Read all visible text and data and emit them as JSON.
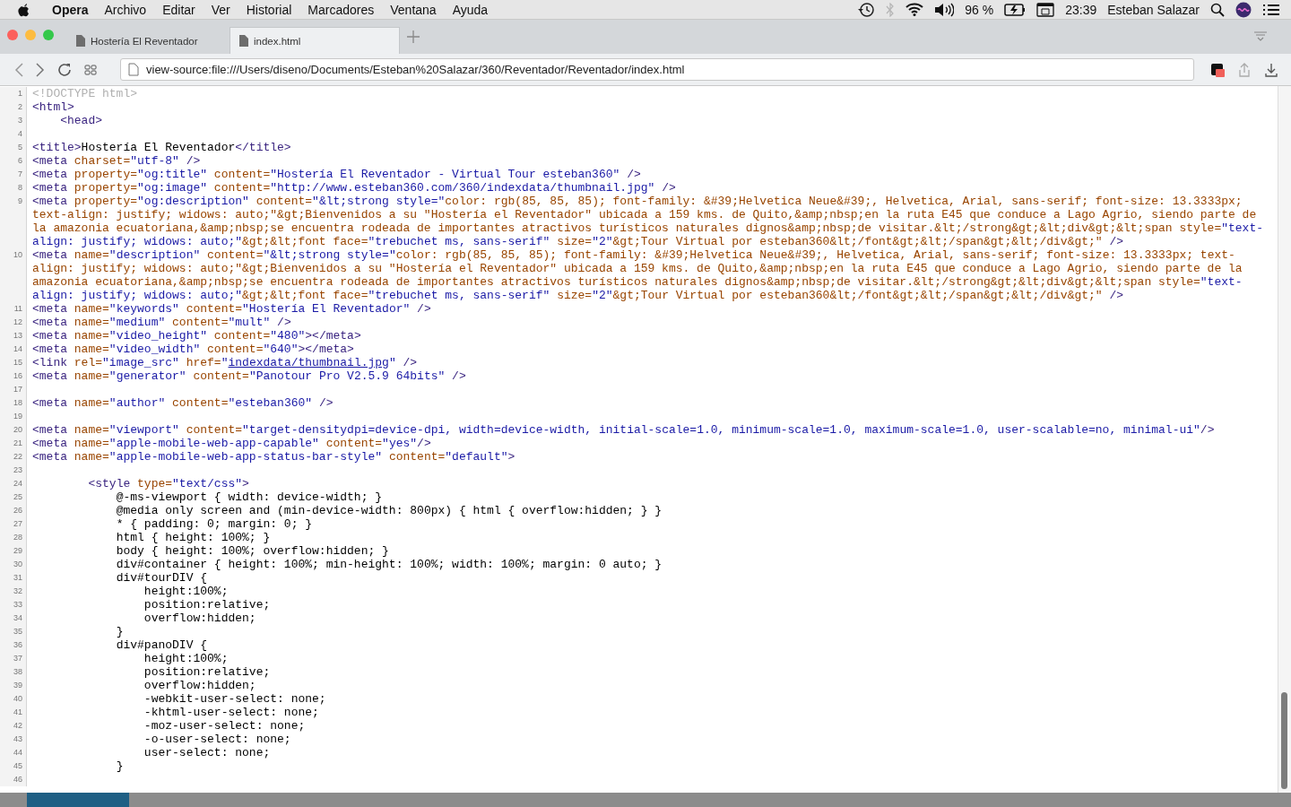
{
  "menubar": {
    "app": "Opera",
    "menus": [
      "Archivo",
      "Editar",
      "Ver",
      "Historial",
      "Marcadores",
      "Ventana",
      "Ayuda"
    ],
    "battery": "96 %",
    "clock": "23:39",
    "user": "Esteban Salazar"
  },
  "tabs": [
    {
      "title": "Hostería El Reventador",
      "selected": false
    },
    {
      "title": "index.html",
      "selected": true
    }
  ],
  "address_bar": {
    "value": "view-source:file:///Users/diseno/Documents/Esteban%20Salazar/360/Reventador/Reventador/index.html"
  },
  "source_lines": [
    {
      "number": "1",
      "segments": [
        {
          "kind": "doctype",
          "text": "<!DOCTYPE html>"
        }
      ]
    },
    {
      "number": "2",
      "segments": [
        {
          "kind": "tag",
          "text": "<html>"
        }
      ]
    },
    {
      "number": "3",
      "segments": [
        {
          "kind": "tag",
          "text": "    <head>"
        }
      ]
    },
    {
      "number": "4"
    },
    {
      "number": "5",
      "segments": [
        {
          "kind": "tag",
          "text": "<title>"
        },
        {
          "kind": "text",
          "text": "Hostería El Reventador"
        },
        {
          "kind": "tag",
          "text": "</title>"
        }
      ]
    },
    {
      "number": "6",
      "segments": [
        {
          "kind": "tag",
          "text": "<meta"
        },
        {
          "kind": "attr",
          "text": " charset="
        },
        {
          "kind": "value",
          "text": "\"utf-8\""
        },
        {
          "kind": "tag",
          "text": " />"
        }
      ]
    },
    {
      "number": "7",
      "segments": [
        {
          "kind": "tag",
          "text": "<meta"
        },
        {
          "kind": "attr",
          "text": " property="
        },
        {
          "kind": "value",
          "text": "\"og:title\""
        },
        {
          "kind": "attr",
          "text": " content="
        },
        {
          "kind": "value",
          "text": "\"Hostería El Reventador - Virtual Tour esteban360\""
        },
        {
          "kind": "tag",
          "text": " />"
        }
      ]
    },
    {
      "number": "8",
      "segments": [
        {
          "kind": "tag",
          "text": "<meta"
        },
        {
          "kind": "attr",
          "text": " property="
        },
        {
          "kind": "value",
          "text": "\"og:image\""
        },
        {
          "kind": "attr",
          "text": " content="
        },
        {
          "kind": "value",
          "text": "\"http://www.esteban360.com/360/indexdata/thumbnail.jpg\""
        },
        {
          "kind": "tag",
          "text": " />"
        }
      ]
    },
    {
      "number": "9",
      "segments": [
        {
          "kind": "tag",
          "text": "<meta"
        },
        {
          "kind": "attr",
          "text": " property="
        },
        {
          "kind": "value",
          "text": "\"og:description\""
        },
        {
          "kind": "attr",
          "text": " content="
        },
        {
          "kind": "value",
          "text": "\"&lt;strong style=\""
        },
        {
          "kind": "attr",
          "text": "color: rgb(85, 85, 85); font-family: &#39;Helvetica Neue&#39;, Helvetica, Arial, sans-serif; font-size: 13.3333px; text-align: justify; widows: auto;\"&gt;Bienvenidos a su \"Hostería el Reventador\" ubicada a 159 kms. de Quito,&amp;nbsp;en la ruta E45 que conduce a Lago Agrio, siendo parte de la amazonia ecuatoriana,&amp;nbsp;se encuentra rodeada de importantes atractivos turísticos naturales dignos&amp;nbsp;de visitar.&lt;/strong&gt;&lt;div&gt;&lt;span style="
        },
        {
          "kind": "value",
          "text": "\"text-align: justify; widows: auto;\""
        },
        {
          "kind": "attr",
          "text": "&gt;&lt;font face="
        },
        {
          "kind": "value",
          "text": "\"trebuchet ms, sans-serif\""
        },
        {
          "kind": "attr",
          "text": " size="
        },
        {
          "kind": "value",
          "text": "\"2\""
        },
        {
          "kind": "attr",
          "text": "&gt;Tour Virtual por esteban360&lt;/font&gt;&lt;/span&gt;&lt;/div&gt;\""
        },
        {
          "kind": "tag",
          "text": " />"
        }
      ]
    },
    {
      "number": "10",
      "segments": [
        {
          "kind": "tag",
          "text": "<meta"
        },
        {
          "kind": "attr",
          "text": " name="
        },
        {
          "kind": "value",
          "text": "\"description\""
        },
        {
          "kind": "attr",
          "text": " content="
        },
        {
          "kind": "value",
          "text": "\"&lt;strong style=\""
        },
        {
          "kind": "attr",
          "text": "color: rgb(85, 85, 85); font-family: &#39;Helvetica Neue&#39;, Helvetica, Arial, sans-serif; font-size: 13.3333px; text-align: justify; widows: auto;\"&gt;Bienvenidos a su \"Hostería el Reventador\" ubicada a 159 kms. de Quito,&amp;nbsp;en la ruta E45 que conduce a Lago Agrio, siendo parte de la amazonia ecuatoriana,&amp;nbsp;se encuentra rodeada de importantes atractivos turísticos naturales dignos&amp;nbsp;de visitar.&lt;/strong&gt;&lt;div&gt;&lt;span style="
        },
        {
          "kind": "value",
          "text": "\"text-align: justify; widows: auto;\""
        },
        {
          "kind": "attr",
          "text": "&gt;&lt;font face="
        },
        {
          "kind": "value",
          "text": "\"trebuchet ms, sans-serif\""
        },
        {
          "kind": "attr",
          "text": " size="
        },
        {
          "kind": "value",
          "text": "\"2\""
        },
        {
          "kind": "attr",
          "text": "&gt;Tour Virtual por esteban360&lt;/font&gt;&lt;/span&gt;&lt;/div&gt;\""
        },
        {
          "kind": "tag",
          "text": " />"
        }
      ]
    },
    {
      "number": "11",
      "segments": [
        {
          "kind": "tag",
          "text": "<meta"
        },
        {
          "kind": "attr",
          "text": " name="
        },
        {
          "kind": "value",
          "text": "\"keywords\""
        },
        {
          "kind": "attr",
          "text": " content="
        },
        {
          "kind": "value",
          "text": "\"Hostería El Reventador\""
        },
        {
          "kind": "tag",
          "text": " />"
        }
      ]
    },
    {
      "number": "12",
      "segments": [
        {
          "kind": "tag",
          "text": "<meta"
        },
        {
          "kind": "attr",
          "text": " name="
        },
        {
          "kind": "value",
          "text": "\"medium\""
        },
        {
          "kind": "attr",
          "text": " content="
        },
        {
          "kind": "value",
          "text": "\"mult\""
        },
        {
          "kind": "tag",
          "text": " />"
        }
      ]
    },
    {
      "number": "13",
      "segments": [
        {
          "kind": "tag",
          "text": "<meta"
        },
        {
          "kind": "attr",
          "text": " name="
        },
        {
          "kind": "value",
          "text": "\"video_height\""
        },
        {
          "kind": "attr",
          "text": " content="
        },
        {
          "kind": "value",
          "text": "\"480\""
        },
        {
          "kind": "tag",
          "text": "></meta>"
        }
      ]
    },
    {
      "number": "14",
      "segments": [
        {
          "kind": "tag",
          "text": "<meta"
        },
        {
          "kind": "attr",
          "text": " name="
        },
        {
          "kind": "value",
          "text": "\"video_width\""
        },
        {
          "kind": "attr",
          "text": " content="
        },
        {
          "kind": "value",
          "text": "\"640\""
        },
        {
          "kind": "tag",
          "text": "></meta>"
        }
      ]
    },
    {
      "number": "15",
      "segments": [
        {
          "kind": "tag",
          "text": "<link"
        },
        {
          "kind": "attr",
          "text": " rel="
        },
        {
          "kind": "value",
          "text": "\"image_src\""
        },
        {
          "kind": "attr",
          "text": " href="
        },
        {
          "kind": "value",
          "text": "\""
        },
        {
          "kind": "link",
          "text": "indexdata/thumbnail.jpg"
        },
        {
          "kind": "value",
          "text": "\""
        },
        {
          "kind": "tag",
          "text": " />"
        }
      ]
    },
    {
      "number": "16",
      "segments": [
        {
          "kind": "tag",
          "text": "<meta"
        },
        {
          "kind": "attr",
          "text": " name="
        },
        {
          "kind": "value",
          "text": "\"generator\""
        },
        {
          "kind": "attr",
          "text": " content="
        },
        {
          "kind": "value",
          "text": "\"Panotour Pro V2.5.9 64bits\""
        },
        {
          "kind": "tag",
          "text": " />"
        }
      ]
    },
    {
      "number": "17"
    },
    {
      "number": "18",
      "segments": [
        {
          "kind": "tag",
          "text": "<meta"
        },
        {
          "kind": "attr",
          "text": " name="
        },
        {
          "kind": "value",
          "text": "\"author\""
        },
        {
          "kind": "attr",
          "text": " content="
        },
        {
          "kind": "value",
          "text": "\"esteban360\""
        },
        {
          "kind": "tag",
          "text": " />"
        }
      ]
    },
    {
      "number": "19"
    },
    {
      "number": "20",
      "segments": [
        {
          "kind": "tag",
          "text": "<meta"
        },
        {
          "kind": "attr",
          "text": " name="
        },
        {
          "kind": "value",
          "text": "\"viewport\""
        },
        {
          "kind": "attr",
          "text": " content="
        },
        {
          "kind": "value",
          "text": "\"target-densitydpi=device-dpi, width=device-width, initial-scale=1.0, minimum-scale=1.0, maximum-scale=1.0, user-scalable=no, minimal-ui\""
        },
        {
          "kind": "tag",
          "text": "/>"
        }
      ]
    },
    {
      "number": "21",
      "segments": [
        {
          "kind": "tag",
          "text": "<meta"
        },
        {
          "kind": "attr",
          "text": " name="
        },
        {
          "kind": "value",
          "text": "\"apple-mobile-web-app-capable\""
        },
        {
          "kind": "attr",
          "text": " content="
        },
        {
          "kind": "value",
          "text": "\"yes\""
        },
        {
          "kind": "tag",
          "text": "/>"
        }
      ]
    },
    {
      "number": "22",
      "segments": [
        {
          "kind": "tag",
          "text": "<meta"
        },
        {
          "kind": "attr",
          "text": " name="
        },
        {
          "kind": "value",
          "text": "\"apple-mobile-web-app-status-bar-style\""
        },
        {
          "kind": "attr",
          "text": " content="
        },
        {
          "kind": "value",
          "text": "\"default\""
        },
        {
          "kind": "tag",
          "text": ">"
        }
      ]
    },
    {
      "number": "23"
    },
    {
      "number": "24",
      "segments": [
        {
          "kind": "tag",
          "text": "        <style"
        },
        {
          "kind": "attr",
          "text": " type="
        },
        {
          "kind": "value",
          "text": "\"text/css\""
        },
        {
          "kind": "tag",
          "text": ">"
        }
      ]
    },
    {
      "number": "25",
      "segments": [
        {
          "kind": "text",
          "text": "            @-ms-viewport { width: device-width; }"
        }
      ]
    },
    {
      "number": "26",
      "segments": [
        {
          "kind": "text",
          "text": "            @media only screen and (min-device-width: 800px) { html { overflow:hidden; } }"
        }
      ]
    },
    {
      "number": "27",
      "segments": [
        {
          "kind": "text",
          "text": "            * { padding: 0; margin: 0; }"
        }
      ]
    },
    {
      "number": "28",
      "segments": [
        {
          "kind": "text",
          "text": "            html { height: 100%; }"
        }
      ]
    },
    {
      "number": "29",
      "segments": [
        {
          "kind": "text",
          "text": "            body { height: 100%; overflow:hidden; }"
        }
      ]
    },
    {
      "number": "30",
      "segments": [
        {
          "kind": "text",
          "text": "            div#container { height: 100%; min-height: 100%; width: 100%; margin: 0 auto; }"
        }
      ]
    },
    {
      "number": "31",
      "segments": [
        {
          "kind": "text",
          "text": "            div#tourDIV {"
        }
      ]
    },
    {
      "number": "32",
      "segments": [
        {
          "kind": "text",
          "text": "                height:100%;"
        }
      ]
    },
    {
      "number": "33",
      "segments": [
        {
          "kind": "text",
          "text": "                position:relative;"
        }
      ]
    },
    {
      "number": "34",
      "segments": [
        {
          "kind": "text",
          "text": "                overflow:hidden;"
        }
      ]
    },
    {
      "number": "35",
      "segments": [
        {
          "kind": "text",
          "text": "            }"
        }
      ]
    },
    {
      "number": "36",
      "segments": [
        {
          "kind": "text",
          "text": "            div#panoDIV {"
        }
      ]
    },
    {
      "number": "37",
      "segments": [
        {
          "kind": "text",
          "text": "                height:100%;"
        }
      ]
    },
    {
      "number": "38",
      "segments": [
        {
          "kind": "text",
          "text": "                position:relative;"
        }
      ]
    },
    {
      "number": "39",
      "segments": [
        {
          "kind": "text",
          "text": "                overflow:hidden;"
        }
      ]
    },
    {
      "number": "40",
      "segments": [
        {
          "kind": "text",
          "text": "                -webkit-user-select: none;"
        }
      ]
    },
    {
      "number": "41",
      "segments": [
        {
          "kind": "text",
          "text": "                -khtml-user-select: none;"
        }
      ]
    },
    {
      "number": "42",
      "segments": [
        {
          "kind": "text",
          "text": "                -moz-user-select: none;"
        }
      ]
    },
    {
      "number": "43",
      "segments": [
        {
          "kind": "text",
          "text": "                -o-user-select: none;"
        }
      ]
    },
    {
      "number": "44",
      "segments": [
        {
          "kind": "text",
          "text": "                user-select: none;"
        }
      ]
    },
    {
      "number": "45",
      "segments": [
        {
          "kind": "text",
          "text": "            }"
        }
      ]
    },
    {
      "number": "46"
    }
  ]
}
